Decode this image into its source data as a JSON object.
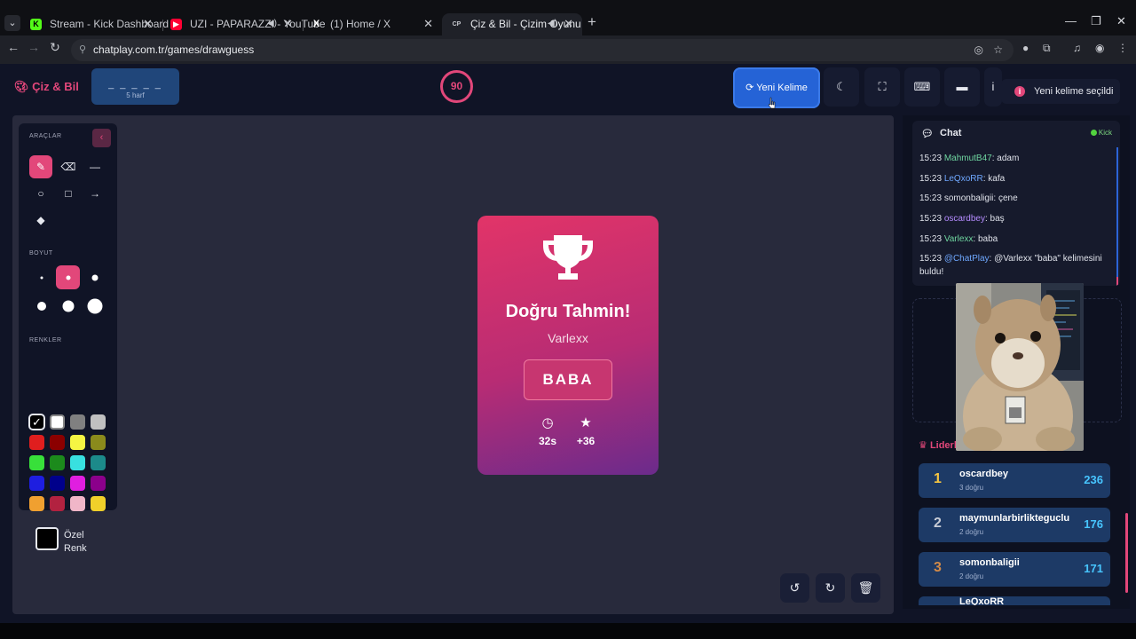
{
  "browser": {
    "tabs": [
      {
        "title": "Stream - Kick Dashboard",
        "fav": "K"
      },
      {
        "title": "UZI - PAPARAZZI - YouTube",
        "fav": "▶"
      },
      {
        "title": "(1) Home / X",
        "fav": "X"
      },
      {
        "title": "Çiz & Bil - Çizim Oyunu",
        "fav": "CP"
      }
    ],
    "url": "chatplay.com.tr/games/drawguess"
  },
  "header": {
    "logo": "Çiz & Bil",
    "word_dashes": "_ _ _ _ _",
    "word_hint": "5 harf",
    "timer": "90",
    "new_word_label": "Yeni Kelime",
    "toast": "Yeni kelime seçildi"
  },
  "tools": {
    "tools_label": "ARAÇLAR",
    "size_label": "BOYUT",
    "colors_label": "RENKLER",
    "custom_color_label": "Özel Renk",
    "colors": [
      "#000000",
      "#ffffff",
      "#808080",
      "#c0c0c0",
      "#e01e1e",
      "#8b0000",
      "#f5f543",
      "#8a8a1c",
      "#38e03a",
      "#1c8a1c",
      "#38e0e0",
      "#1c8a8a",
      "#1e1ee0",
      "#00008b",
      "#e01ee0",
      "#8b008b",
      "#f0a030",
      "#b22240",
      "#f0b6c8",
      "#f0d02a"
    ]
  },
  "result": {
    "title": "Doğru Tahmin!",
    "player": "Varlexx",
    "answer": "BABA",
    "time": "32s",
    "points": "+36"
  },
  "chat": {
    "title": "Chat",
    "platform": "Kick",
    "messages": [
      {
        "time": "15:23",
        "user": "MahmutB47",
        "color": "#6fd6a0",
        "text": ": adam"
      },
      {
        "time": "15:23",
        "user": "LeQxoRR",
        "color": "#6fa8ff",
        "text": ": kafa"
      },
      {
        "time": "15:23",
        "user": "somonbaligii",
        "color": "#dfe2ea",
        "text": ": çene"
      },
      {
        "time": "15:23",
        "user": "oscardbey",
        "color": "#b58cff",
        "text": ": baş"
      },
      {
        "time": "15:23",
        "user": "Varlexx",
        "color": "#6fd6a0",
        "text": ": baba"
      },
      {
        "time": "15:23",
        "user": "@ChatPlay",
        "color": "#6fa8ff",
        "text": ": @Varlexx \"baba\" kelimesini buldu!"
      }
    ]
  },
  "leaderboard": {
    "title": "Liderl",
    "entries": [
      {
        "rank": "1",
        "name": "oscardbey",
        "sub": "3 doğru",
        "points": "236",
        "rank_color": "#f5c542"
      },
      {
        "rank": "2",
        "name": "maymunlarbirlikteguclu",
        "sub": "2 doğru",
        "points": "176",
        "rank_color": "#c8ccd6"
      },
      {
        "rank": "3",
        "name": "somonbaligii",
        "sub": "2 doğru",
        "points": "171",
        "rank_color": "#d28a48"
      },
      {
        "rank": "",
        "name": "LeQxoRR",
        "sub": "",
        "points": "",
        "rank_color": "#c8ccd6"
      }
    ]
  }
}
